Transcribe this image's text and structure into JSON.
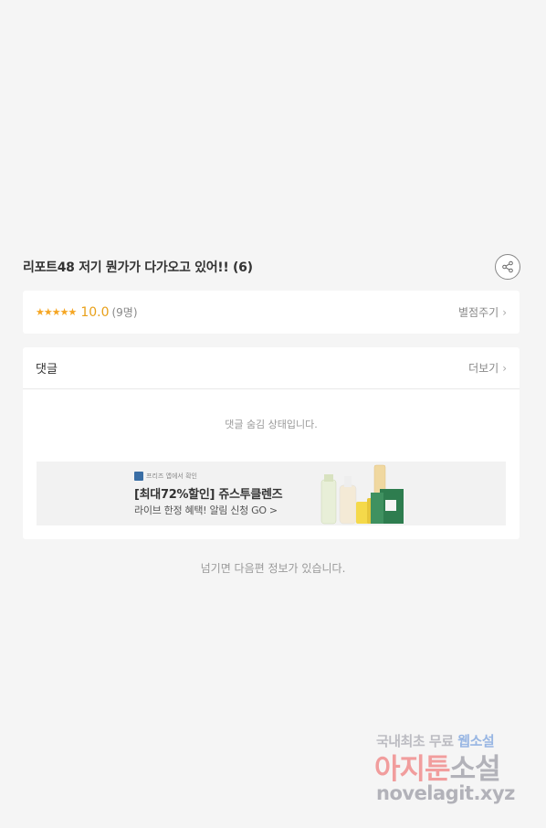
{
  "episode": {
    "title": "리포트48 저기 뭔가가 다가오고 있어!! (6)"
  },
  "rating": {
    "stars": "★★★★★",
    "score": "10.0",
    "count": "(9명)",
    "rate_link": "별점주기",
    "accent_color": "#f5a623"
  },
  "comments": {
    "title": "댓글",
    "more_link": "더보기",
    "hidden_message": "댓글 숨김 상태입니다."
  },
  "ad": {
    "brand": "프리즈 앱에서 확인",
    "title": "[최대72%할인] 쥬스투클렌즈",
    "subtitle": "라이브 한정 혜택! 알림 신청 GO >"
  },
  "next_info": "넘기면 다음편 정보가 있습니다.",
  "watermark": {
    "line1_a": "국내최초 무료",
    "line1_b": "웹소설",
    "line2_a": "아지툰",
    "line2_b": "소설",
    "line3": "novelagit.xyz"
  },
  "icons": {
    "share": "share-icon",
    "chevron": "chevron-right-icon"
  }
}
